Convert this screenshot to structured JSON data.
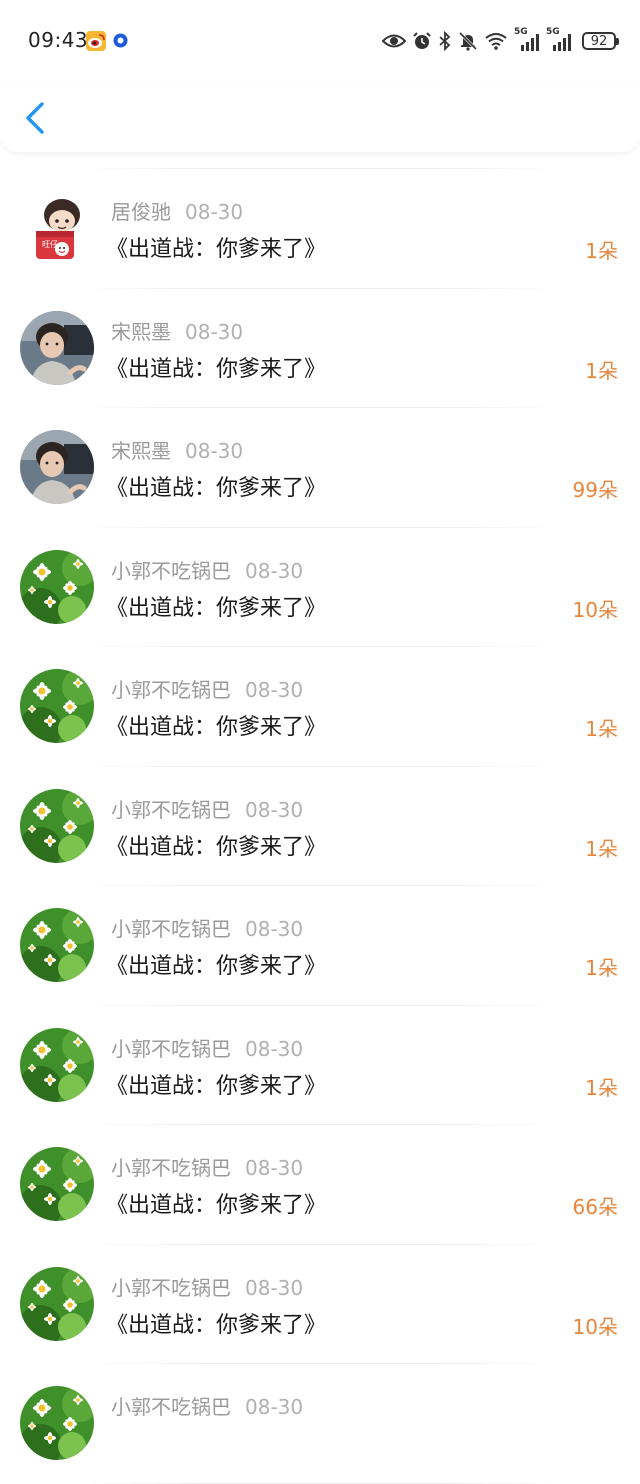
{
  "status_bar": {
    "time": "09:43",
    "battery": "92",
    "network_label_1": "5G",
    "network_label_2": "5G"
  },
  "nav": {
    "back_icon": "chevron-left-icon",
    "accent_color": "#2196f3"
  },
  "items": [
    {
      "name": "居俊驰",
      "date": "08-30",
      "title": "《出道战：你爹来了》",
      "count": "1朵",
      "avatar": "cartoon"
    },
    {
      "name": "宋熙墨",
      "date": "08-30",
      "title": "《出道战：你爹来了》",
      "count": "1朵",
      "avatar": "photo"
    },
    {
      "name": "宋熙墨",
      "date": "08-30",
      "title": "《出道战：你爹来了》",
      "count": "99朵",
      "avatar": "photo"
    },
    {
      "name": "小郭不吃锅巴",
      "date": "08-30",
      "title": "《出道战：你爹来了》",
      "count": "10朵",
      "avatar": "daisy"
    },
    {
      "name": "小郭不吃锅巴",
      "date": "08-30",
      "title": "《出道战：你爹来了》",
      "count": "1朵",
      "avatar": "daisy"
    },
    {
      "name": "小郭不吃锅巴",
      "date": "08-30",
      "title": "《出道战：你爹来了》",
      "count": "1朵",
      "avatar": "daisy"
    },
    {
      "name": "小郭不吃锅巴",
      "date": "08-30",
      "title": "《出道战：你爹来了》",
      "count": "1朵",
      "avatar": "daisy"
    },
    {
      "name": "小郭不吃锅巴",
      "date": "08-30",
      "title": "《出道战：你爹来了》",
      "count": "1朵",
      "avatar": "daisy"
    },
    {
      "name": "小郭不吃锅巴",
      "date": "08-30",
      "title": "《出道战：你爹来了》",
      "count": "66朵",
      "avatar": "daisy"
    },
    {
      "name": "小郭不吃锅巴",
      "date": "08-30",
      "title": "《出道战：你爹来了》",
      "count": "10朵",
      "avatar": "daisy"
    },
    {
      "name": "小郭不吃锅巴",
      "date": "08-30",
      "title": "",
      "count": "",
      "avatar": "daisy"
    }
  ],
  "colors": {
    "count": "#e8853c",
    "name": "#9a9a9a",
    "title": "#1a1a1a"
  }
}
